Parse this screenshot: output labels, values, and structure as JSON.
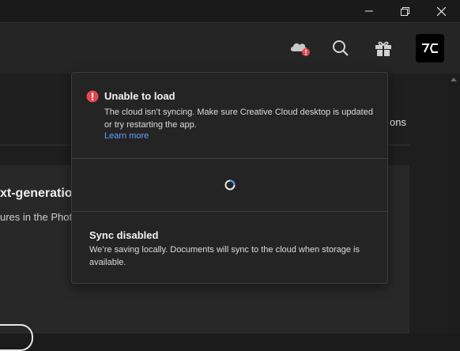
{
  "window": {
    "minimize_icon": "minimize-icon",
    "restore_icon": "restore-icon",
    "close_icon": "close-icon"
  },
  "header": {
    "cloud_status_icon": "cloud-error-icon",
    "search_icon": "search-icon",
    "gift_icon": "gift-icon",
    "app_badge_icon": "app-logo-icon"
  },
  "background": {
    "heading": "xt-generation",
    "subtext": "ures in the Photo",
    "right_text": "ons"
  },
  "popover": {
    "error": {
      "title": "Unable to load",
      "body": "The cloud isn’t syncing. Make sure Creative Cloud desktop is updated or try restarting the app.",
      "link": "Learn more"
    },
    "sync": {
      "title": "Sync disabled",
      "body": "We’re saving locally. Documents will sync to the cloud when storage is available."
    }
  },
  "colors": {
    "error_red": "#e34850",
    "link_blue": "#5ea1ff",
    "spinner_blue": "#4b9cf5"
  }
}
